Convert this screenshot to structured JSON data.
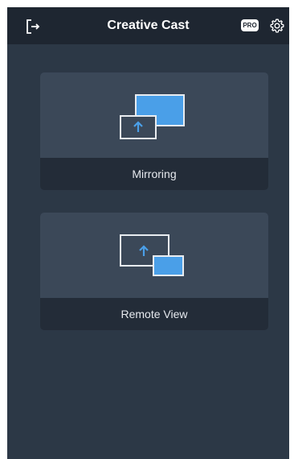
{
  "header": {
    "title": "Creative Cast",
    "pro_label": "PRO",
    "exit_icon": "exit-icon",
    "settings_icon": "gear-icon"
  },
  "cards": [
    {
      "label": "Mirroring",
      "icon": "screen-mirroring-icon"
    },
    {
      "label": "Remote View",
      "icon": "remote-view-icon"
    }
  ],
  "colors": {
    "header_bg": "#1e2631",
    "app_bg": "#2c3846",
    "card_top": "#3b4858",
    "card_bottom": "#232c38",
    "accent_blue": "#4a9fe8"
  }
}
